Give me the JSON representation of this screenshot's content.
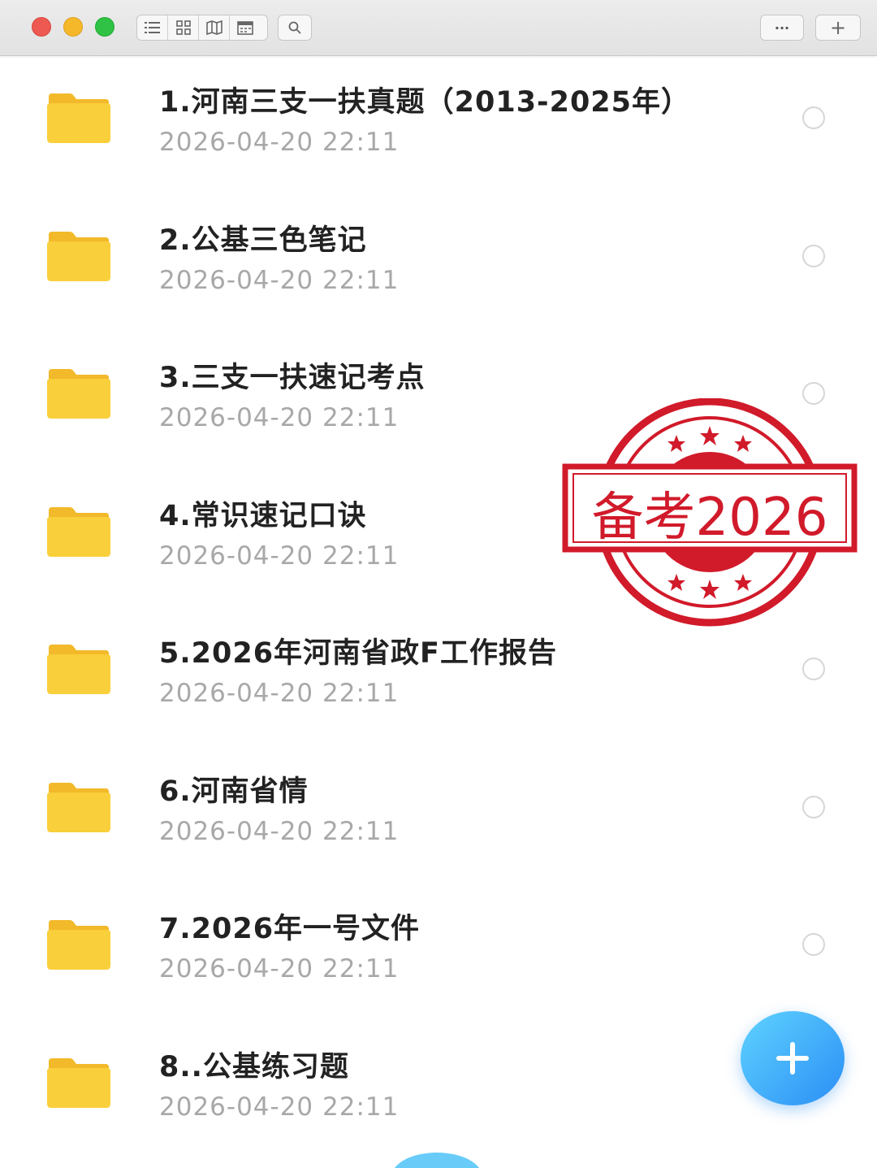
{
  "toolbar": {
    "view_icons": [
      "list-view-icon",
      "grid-view-icon",
      "map-view-icon",
      "calendar-view-icon"
    ],
    "search_icon": "search-icon",
    "more_label": "···",
    "add_label": "+"
  },
  "files": [
    {
      "name": "1.河南三支一扶真题（2013-2025年）",
      "date": "2026-04-20  22:11"
    },
    {
      "name": "2.公基三色笔记",
      "date": "2026-04-20  22:11"
    },
    {
      "name": "3.三支一扶速记考点",
      "date": "2026-04-20  22:11"
    },
    {
      "name": "4.常识速记口诀",
      "date": "2026-04-20  22:11"
    },
    {
      "name": "5.2026年河南省政F工作报告",
      "date": "2026-04-20  22:11"
    },
    {
      "name": "6.河南省情",
      "date": "2026-04-20  22:11"
    },
    {
      "name": "7.2026年一号文件",
      "date": "2026-04-20  22:11"
    },
    {
      "name": "8..公基练习题",
      "date": "2026-04-20  22:11"
    }
  ],
  "stamp": {
    "text": "备考2026",
    "color": "#d11a2a"
  },
  "colors": {
    "folder": "#f9cf3b",
    "fab": "#2b8ef5"
  }
}
